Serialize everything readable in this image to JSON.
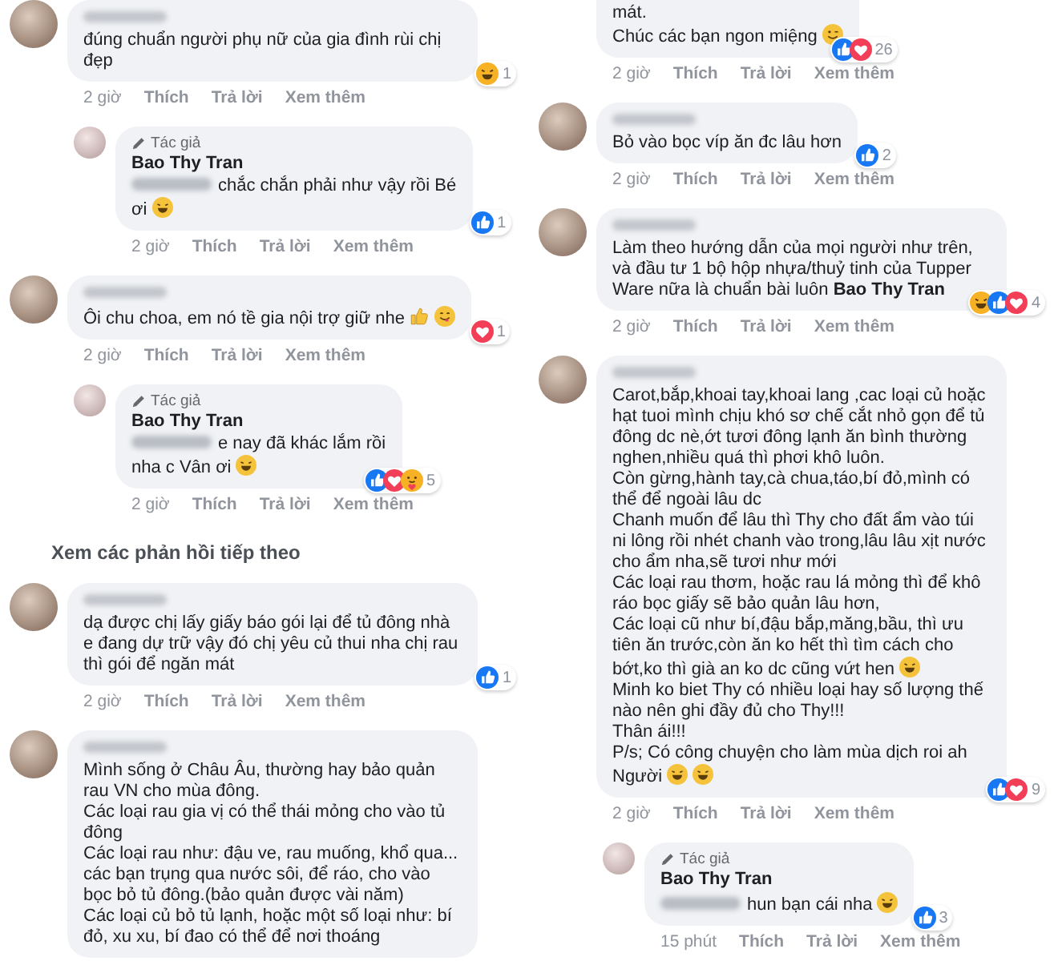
{
  "columns": [
    {
      "items": [
        {
          "kind": "comment",
          "reply": false,
          "continued": false,
          "author_hidden": true,
          "content": [
            [
              {
                "kind": "text",
                "text": "đúng chuẩn người phụ nữ của gia đình rùi chị đẹp"
              }
            ]
          ],
          "reactions": [
            {
              "kind": "haha"
            }
          ],
          "reaction_count": "1",
          "time": "2 giờ",
          "actions": [
            "Thích",
            "Trả lời",
            "Xem thêm"
          ]
        },
        {
          "kind": "comment",
          "reply": true,
          "continued": false,
          "badge": "Tác giả",
          "author": "Bao Thy Tran",
          "content": [
            [
              {
                "kind": "mention"
              },
              {
                "kind": "text",
                "text": "chắc chắn phải như vậy rồi Bé"
              }
            ],
            [
              {
                "kind": "text",
                "text": "ơi"
              },
              {
                "kind": "laugh"
              }
            ]
          ],
          "reactions": [
            {
              "kind": "like"
            }
          ],
          "reaction_count": "1",
          "time": "2 giờ",
          "actions": [
            "Thích",
            "Trả lời",
            "Xem thêm"
          ]
        },
        {
          "kind": "comment",
          "reply": false,
          "continued": false,
          "author_hidden": true,
          "content": [
            [
              {
                "kind": "text",
                "text": "Ôi chu choa, em nó tề gia nội trợ giữ nhe"
              },
              {
                "kind": "thumbs"
              },
              {
                "kind": "yum"
              }
            ]
          ],
          "reactions": [
            {
              "kind": "love"
            }
          ],
          "reaction_count": "1",
          "time": "2 giờ",
          "actions": [
            "Thích",
            "Trả lời",
            "Xem thêm"
          ]
        },
        {
          "kind": "comment",
          "reply": true,
          "continued": false,
          "badge": "Tác giả",
          "author": "Bao Thy Tran",
          "content": [
            [
              {
                "kind": "mention"
              },
              {
                "kind": "text",
                "text": "e nay đã khác lắm rồi"
              }
            ],
            [
              {
                "kind": "text",
                "text": "nha c Vân ơi"
              },
              {
                "kind": "laugh"
              }
            ]
          ],
          "reactions": [
            {
              "kind": "like"
            },
            {
              "kind": "love"
            },
            {
              "kind": "care"
            }
          ],
          "reaction_count": "5",
          "time": "2 giờ",
          "actions": [
            "Thích",
            "Trả lời",
            "Xem thêm"
          ]
        },
        {
          "kind": "more_replies",
          "label": "Xem các phản hồi tiếp theo"
        },
        {
          "kind": "comment",
          "reply": false,
          "continued": false,
          "author_hidden": true,
          "content": [
            [
              {
                "kind": "text",
                "text": "dạ được chị lấy giấy báo gói lại để tủ đông nhà e đang dự trữ vậy đó chị yêu củ thui nha chị rau thì gói để ngăn mát"
              }
            ]
          ],
          "reactions": [
            {
              "kind": "like"
            }
          ],
          "reaction_count": "1",
          "time": "2 giờ",
          "actions": [
            "Thích",
            "Trả lời",
            "Xem thêm"
          ]
        },
        {
          "kind": "comment",
          "reply": false,
          "continued": false,
          "author_hidden": true,
          "content": [
            [
              {
                "kind": "text",
                "text": "Mình sống ở Châu Âu, thường hay bảo quản rau VN cho mùa đông.\nCác loại rau gia vị có thể thái mỏng cho vào tủ đông\nCác loại rau như: đậu ve, rau muống, khổ qua... các bạn trụng qua nước sôi, để ráo, cho vào bọc bỏ tủ đông.(bảo quản được vài năm)\nCác loại củ bỏ tủ lạnh, hoặc một số loại như: bí đỏ, xu xu, bí đao có thể để nơi thoáng"
              }
            ]
          ]
        }
      ]
    },
    {
      "items": [
        {
          "kind": "comment",
          "reply": false,
          "continued": true,
          "content": [
            [
              {
                "kind": "text",
                "text": "mát."
              }
            ],
            [
              {
                "kind": "text",
                "text": "Chúc các bạn ngon miệng"
              },
              {
                "kind": "wink"
              }
            ]
          ],
          "reactions": [
            {
              "kind": "like"
            },
            {
              "kind": "love"
            }
          ],
          "reaction_count": "26",
          "time": "2 giờ",
          "actions": [
            "Thích",
            "Trả lời",
            "Xem thêm"
          ]
        },
        {
          "kind": "comment",
          "reply": false,
          "continued": false,
          "author_hidden": true,
          "content": [
            [
              {
                "kind": "text",
                "text": "Bỏ vào bọc víp ăn đc lâu hơn"
              }
            ]
          ],
          "reactions": [
            {
              "kind": "like"
            }
          ],
          "reaction_count": "2",
          "time": "2 giờ",
          "actions": [
            "Thích",
            "Trả lời",
            "Xem thêm"
          ]
        },
        {
          "kind": "comment",
          "reply": false,
          "continued": false,
          "author_hidden": true,
          "content": [
            [
              {
                "kind": "text",
                "text": "Làm theo hướng dẫn của mọi người như trên, và đầu tư 1 bộ hộp nhựa/thuỷ tinh của Tupper Ware nữa là chuẩn bài luôn **Bao Thy Tran**"
              }
            ]
          ],
          "reactions": [
            {
              "kind": "haha"
            },
            {
              "kind": "like"
            },
            {
              "kind": "love"
            }
          ],
          "reaction_count": "4",
          "time": "2 giờ",
          "actions": [
            "Thích",
            "Trả lời",
            "Xem thêm"
          ]
        },
        {
          "kind": "comment",
          "reply": false,
          "continued": false,
          "author_hidden": true,
          "content": [
            [
              {
                "kind": "text",
                "text": "Carot,bắp,khoai tay,khoai lang ,cac loại củ hoặc hạt tuoi mình chịu khó sơ chế cắt nhỏ gọn để tủ đông dc nè,ớt tươi đông lạnh ăn bình thường nghen,nhiều quá thì phơi khô luôn.\nCòn gừng,hành tay,cà chua,táo,bí đỏ,mình có thể để ngoài lâu dc\nChanh muốn để lâu thì Thy cho đất ẩm vào túi ni lông rồi nhét chanh vào trong,lâu lâu xịt nước cho ẩm nha,sẽ tươi như mới\nCác loại rau thơm, hoặc rau lá mỏng thì để khô ráo bọc giấy sẽ bảo quản lâu hơn,\nCác loại cũ như bí,đậu bắp,măng,bầu, thì ưu tiên ăn trước,còn ăn ko hết thì tìm cách cho"
              }
            ],
            [
              {
                "kind": "text",
                "text": "bớt,ko thì già an ko dc cũng vứt hen"
              },
              {
                "kind": "laugh"
              }
            ],
            [
              {
                "kind": "text",
                "text": "Minh ko biet Thy có nhiều loại hay số lượng thế nào nên ghi đầy đủ cho Thy!!!\nThân ái!!!\nP/s; Có công chuyện cho làm mùa dịch roi ah"
              }
            ],
            [
              {
                "kind": "text",
                "text": "Người"
              },
              {
                "kind": "laugh"
              },
              {
                "kind": "laugh"
              }
            ]
          ],
          "reactions": [
            {
              "kind": "like"
            },
            {
              "kind": "love"
            }
          ],
          "reaction_count": "9",
          "time": "2 giờ",
          "actions": [
            "Thích",
            "Trả lời",
            "Xem thêm"
          ]
        },
        {
          "kind": "comment",
          "reply": true,
          "continued": false,
          "badge": "Tác giả",
          "author": "Bao Thy Tran",
          "content": [
            [
              {
                "kind": "mention"
              },
              {
                "kind": "text",
                "text": "hun bạn cái nha"
              },
              {
                "kind": "laugh"
              }
            ]
          ],
          "reactions": [
            {
              "kind": "like"
            }
          ],
          "reaction_count": "3",
          "time": "15 phút",
          "actions": [
            "Thích",
            "Trả lời",
            "Xem thêm"
          ]
        }
      ]
    }
  ]
}
